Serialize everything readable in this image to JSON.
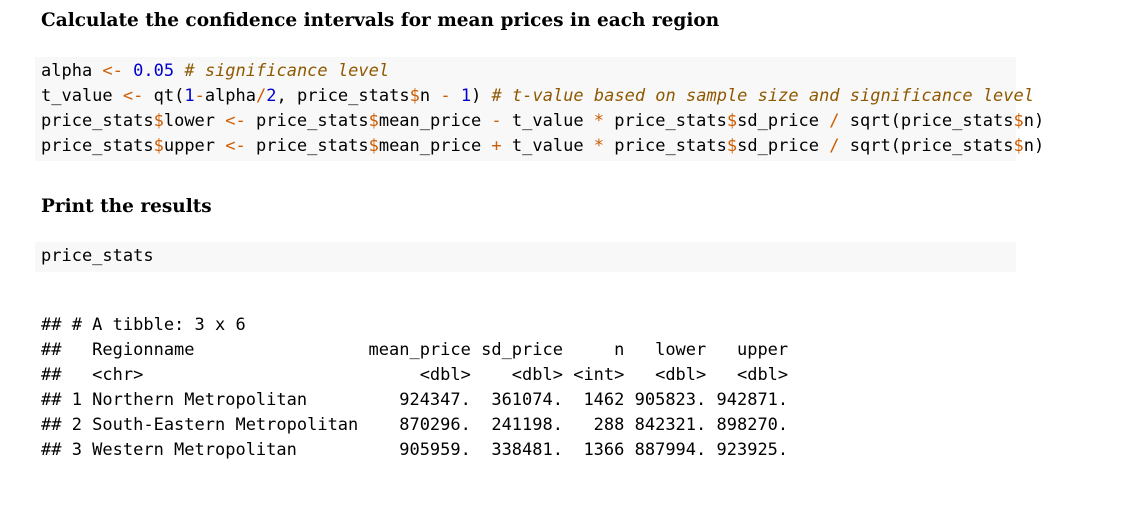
{
  "heading1": "Calculate the confidence intervals for mean prices in each region",
  "heading2": "Print the results",
  "code_block1": {
    "line1": {
      "a": "alpha ",
      "op1": "<-",
      "b": " ",
      "num1": "0.05",
      "c": " ",
      "comment": "# significance level"
    },
    "line2": {
      "a": "t_value ",
      "op1": "<-",
      "b": " qt(",
      "num1": "1",
      "op2": "-",
      "c": "alpha",
      "op3": "/",
      "num2": "2",
      "d": ", price_stats",
      "op4": "$",
      "e": "n ",
      "op5": "-",
      "f": " ",
      "num3": "1",
      "g": ") ",
      "comment": "# t-value based on sample size and significance level"
    },
    "line3": {
      "a": "price_stats",
      "op1": "$",
      "b": "lower ",
      "op2": "<-",
      "c": " price_stats",
      "op3": "$",
      "d": "mean_price ",
      "op4": "-",
      "e": " t_value ",
      "op5": "*",
      "f": " price_stats",
      "op6": "$",
      "g": "sd_price ",
      "op7": "/",
      "h": " sqrt(price_stats",
      "op8": "$",
      "i": "n)"
    },
    "line4": {
      "a": "price_stats",
      "op1": "$",
      "b": "upper ",
      "op2": "<-",
      "c": " price_stats",
      "op3": "$",
      "d": "mean_price ",
      "op4": "+",
      "e": " t_value ",
      "op5": "*",
      "f": " price_stats",
      "op6": "$",
      "g": "sd_price ",
      "op7": "/",
      "h": " sqrt(price_stats",
      "op8": "$",
      "i": "n)"
    }
  },
  "code_block2": {
    "line1": "price_stats"
  },
  "output": {
    "lines": [
      "## # A tibble: 3 x 6",
      "##   Regionname                 mean_price sd_price     n   lower   upper",
      "##   <chr>                           <dbl>    <dbl> <int>   <dbl>   <dbl>",
      "## 1 Northern Metropolitan         924347.  361074.  1462 905823. 942871.",
      "## 2 South-Eastern Metropolitan    870296.  241198.   288 842321. 898270.",
      "## 3 Western Metropolitan          905959.  338481.  1366 887994. 923925."
    ]
  }
}
